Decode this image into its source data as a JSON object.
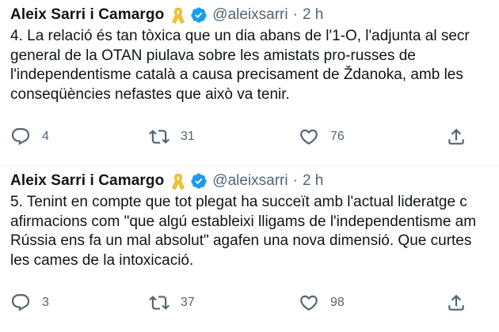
{
  "tweets": [
    {
      "author_name": "Aleix Sarri i Camargo",
      "handle": "@aleixsarri",
      "separator": "·",
      "time": "2 h",
      "lines": [
        "4. La relació és tan tòxica que un dia abans de l'1-O, l'adjunta al secr",
        "general de la OTAN piulava sobre les amistats pro-russes de",
        "l'independentisme català a causa precisament de Ždanoka, amb les",
        "conseqüències nefastes que això va tenir."
      ],
      "replies": "4",
      "retweets": "31",
      "likes": "76"
    },
    {
      "author_name": "Aleix Sarri i Camargo",
      "handle": "@aleixsarri",
      "separator": "·",
      "time": "2 h",
      "lines": [
        "5. Tenint en compte que tot plegat ha succeït amb l'actual lideratge c",
        "afirmacions com \"que algú estableixi lligams de l'independentisme am",
        "Rússia ens fa un mal absolut\" agafen una nova dimensió. Que curtes",
        "les cames de la intoxicació."
      ],
      "replies": "3",
      "retweets": "37",
      "likes": "98"
    }
  ],
  "icons": {
    "ribbon": "yellow-ribbon-icon",
    "verified": "verified-badge-icon",
    "reply": "reply-icon",
    "retweet": "retweet-icon",
    "like": "heart-icon",
    "share": "share-icon"
  },
  "colors": {
    "text": "#0f1419",
    "secondary": "#536471",
    "verified": "#1d9bf0",
    "ribbon": "#f4c430"
  }
}
